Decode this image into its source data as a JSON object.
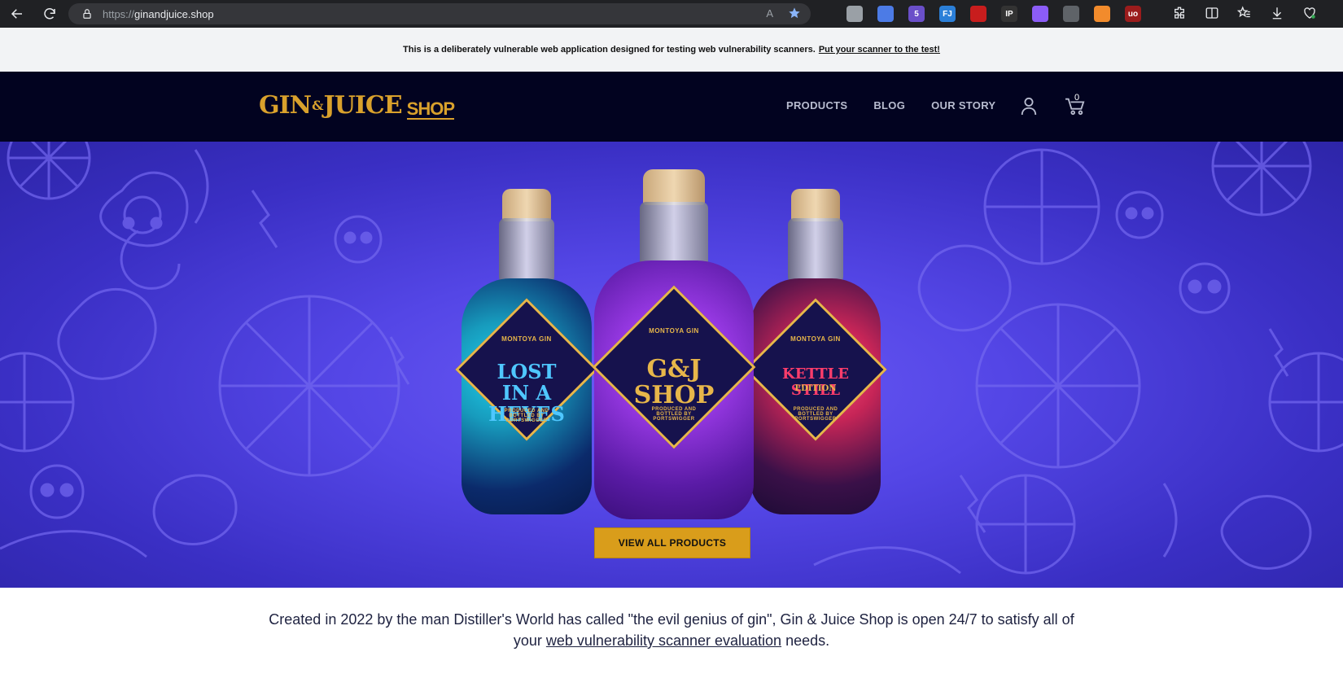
{
  "browser": {
    "url_scheme": "https://",
    "url_host": "ginandjuice.shop",
    "reader_label": "A",
    "extensions": [
      {
        "icon": "circle-extension-icon",
        "color": "#9aa0a6",
        "text": ""
      },
      {
        "icon": "shield-extension-icon",
        "color": "#4c7be6",
        "text": ""
      },
      {
        "icon": "hexagon-extension-icon",
        "color": "#6a4fc9",
        "text": "5"
      },
      {
        "icon": "fj-extension-icon",
        "color": "#2b7fd8",
        "text": "FJ"
      },
      {
        "icon": "drop-extension-icon",
        "color": "#c81d1d",
        "text": ""
      },
      {
        "icon": "ip-extension-icon",
        "color": "#333333",
        "text": "IP"
      },
      {
        "icon": "flame-extension-icon",
        "color": "#8b5cf6",
        "text": ""
      },
      {
        "icon": "card-extension-icon",
        "color": "#5f6368",
        "text": ""
      },
      {
        "icon": "orange-extension-icon",
        "color": "#f28b2c",
        "text": ""
      },
      {
        "icon": "ublock-extension-icon",
        "color": "#9b1c1c",
        "text": "uo"
      }
    ]
  },
  "notice": {
    "text": "This is a deliberately vulnerable web application designed for testing web vulnerability scanners.",
    "link": "Put your scanner to the test!"
  },
  "header": {
    "logo_gin": "GIN",
    "logo_amp": "&",
    "logo_juice": "JUICE",
    "logo_shop": "SHOP",
    "nav": [
      "PRODUCTS",
      "BLOG",
      "OUR STORY"
    ],
    "cart_count": "0"
  },
  "hero": {
    "bottles": [
      {
        "brand": "MONTOYA GIN",
        "name": "LOST IN A HEYES",
        "maker": "PRODUCED AND BOTTLED BY PORTSWIGGER",
        "color": "#24c4e6"
      },
      {
        "brand": "MONTOYA GIN",
        "name": "G&J SHOP",
        "maker": "PRODUCED AND BOTTLED BY PORTSWIGGER",
        "color": "#9c39e8"
      },
      {
        "brand": "MONTOYA GIN",
        "name": "KETTLE STILL",
        "sub": "EDITION",
        "maker": "PRODUCED AND BOTTLED BY PORTSWIGGER",
        "color": "#ef3d6e"
      }
    ],
    "cta": "VIEW ALL PRODUCTS"
  },
  "intro": {
    "text_before": "Created in 2022 by the man Distiller's World has called \"the evil genius of gin\", Gin & Juice Shop is open 24/7 to satisfy all of your",
    "link": "web vulnerability scanner evaluation",
    "text_after": "needs."
  }
}
